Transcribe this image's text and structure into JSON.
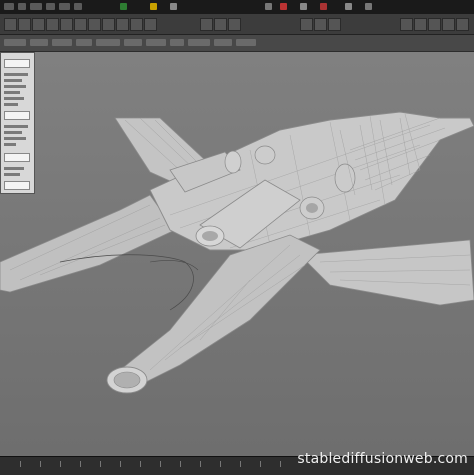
{
  "watermark": {
    "text": "stablediffusionweb.com"
  },
  "viewport": {
    "model": "3d-aircraft-wireframe-mesh"
  },
  "colors": {
    "background": "#7a7a7a",
    "mesh": "#c8c8c8",
    "wire": "#8e8e8e",
    "panel": "#d8d8d8"
  }
}
